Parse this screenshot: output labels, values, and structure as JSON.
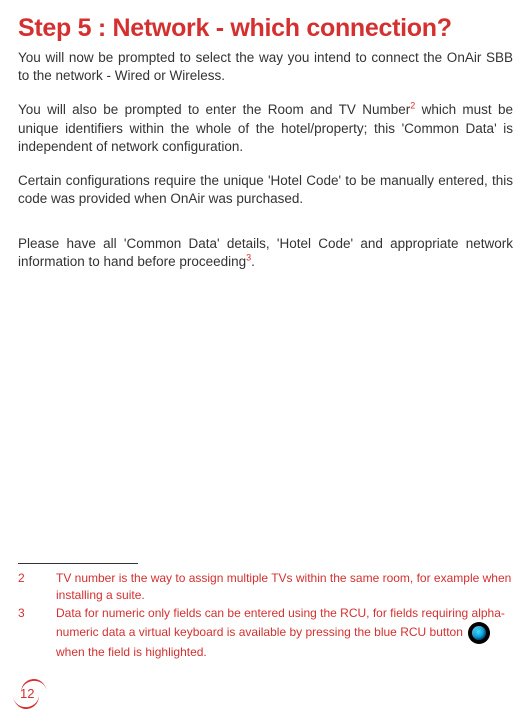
{
  "heading": "Step 5 : Network - which connection?",
  "para1_a": "You will now be prompted to select the way you intend to connect the OnAir SBB to the network - Wired or Wireless.",
  "para2_a": "You will also be prompted to enter the Room and TV Number",
  "para2_sup": "2",
  "para2_b": "  which must be unique identifiers within the whole of the hotel/property; this 'Common Data' is independent of network configuration.",
  "para3": "Certain configurations require the unique 'Hotel Code' to be manually entered, this code was provided when OnAir was purchased.",
  "para4_a": "Please have all 'Common Data' details, 'Hotel Code' and appropriate network information to hand before proceeding",
  "para4_sup": "3",
  "para4_b": ".",
  "footnotes": {
    "f2_num": "2",
    "f2_text": "TV number is the way to assign multiple TVs within the same room, for example when installing a suite.",
    "f3_num": "3",
    "f3_text_a": "Data for numeric only fields can be entered using the RCU, for fields requiring alpha-numeric data a virtual keyboard is available by pressing the blue RCU button ",
    "f3_text_b": " when the field is highlighted."
  },
  "page_number": "12"
}
